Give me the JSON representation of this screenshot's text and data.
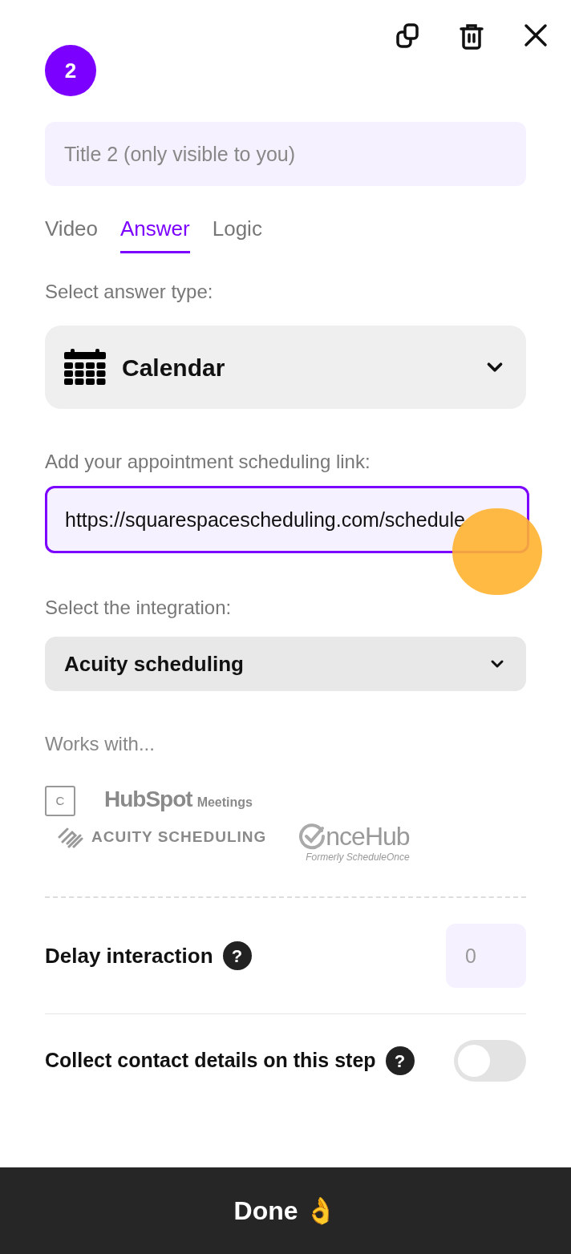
{
  "step_number": "2",
  "title_field": {
    "placeholder": "Title 2 (only visible to you)"
  },
  "tabs": [
    {
      "label": "Video",
      "selected": false
    },
    {
      "label": "Answer",
      "selected": true
    },
    {
      "label": "Logic",
      "selected": false
    }
  ],
  "answer_type": {
    "label": "Select answer type:",
    "value": "Calendar"
  },
  "link": {
    "label": "Add your appointment scheduling link:",
    "value": "https://squarespacescheduling.com/schedule"
  },
  "integration": {
    "label": "Select the integration:",
    "value": "Acuity scheduling"
  },
  "works_with": {
    "label": "Works with...",
    "logos": [
      {
        "kind": "calendar",
        "text": "C"
      },
      {
        "kind": "hubspot",
        "text": "HubSpot",
        "sub": "Meetings"
      },
      {
        "kind": "acuity",
        "text": "ACUITY SCHEDULING"
      },
      {
        "kind": "oncehub",
        "text": "nceHub",
        "sub": "Formerly ScheduleOnce"
      }
    ]
  },
  "delay": {
    "label": "Delay interaction",
    "help": "?",
    "placeholder": "0"
  },
  "collect_contact": {
    "label": "Collect contact details on this step",
    "help": "?",
    "on": false
  },
  "done_button": "Done 👌"
}
